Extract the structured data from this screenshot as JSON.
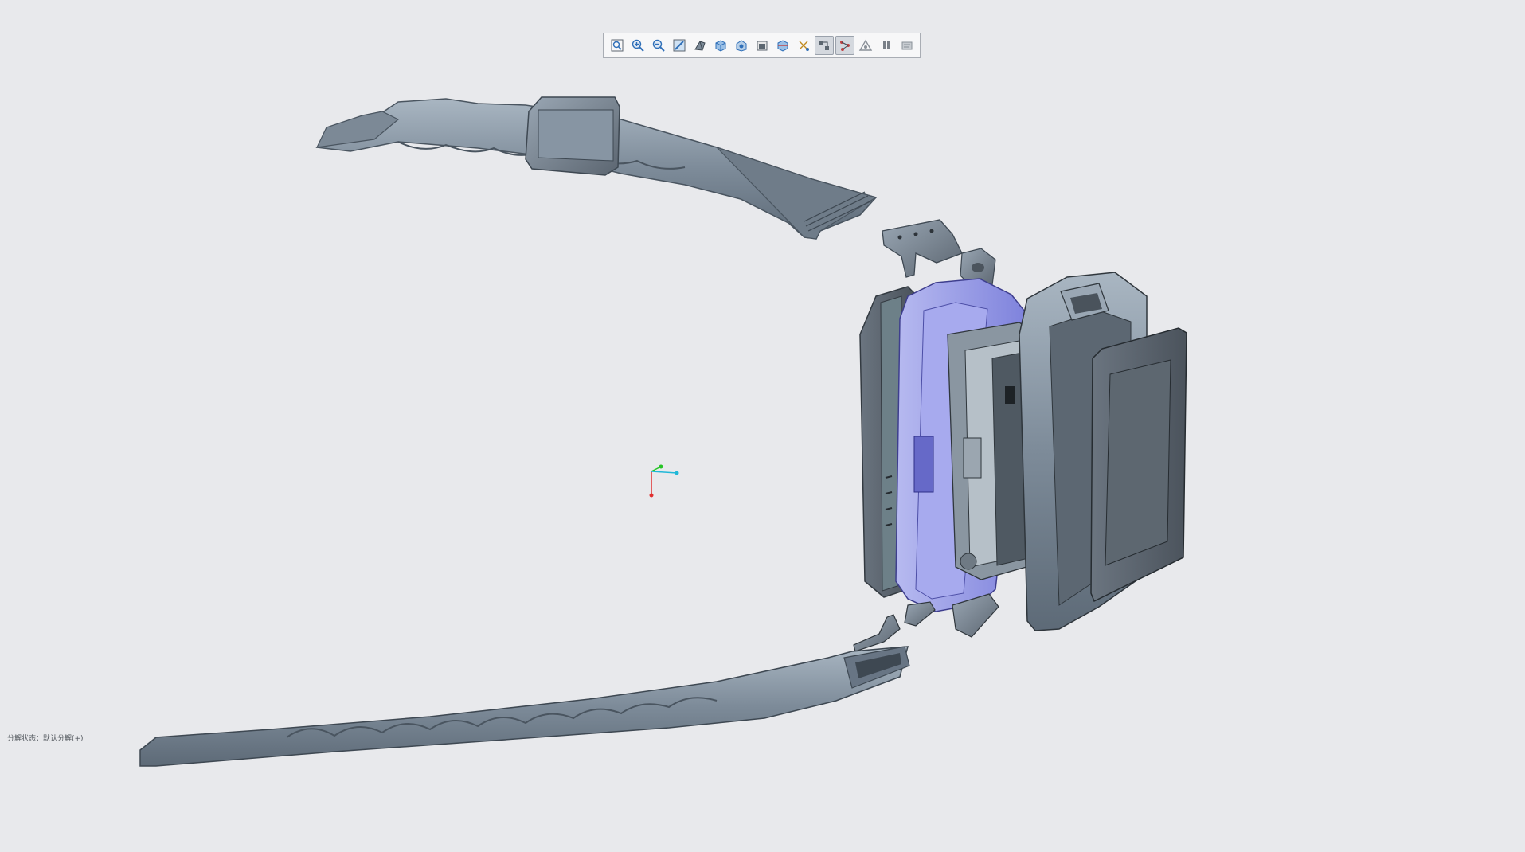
{
  "toolbar": {
    "buttons": [
      {
        "icon": "zoom-fit-icon",
        "active": false
      },
      {
        "icon": "zoom-in-icon",
        "active": false
      },
      {
        "icon": "zoom-out-icon",
        "active": false
      },
      {
        "icon": "repaint-icon",
        "active": false
      },
      {
        "icon": "perspective-icon",
        "active": false
      },
      {
        "icon": "display-style-icon",
        "active": false
      },
      {
        "icon": "saved-views-icon",
        "active": false
      },
      {
        "icon": "view-manager-icon",
        "active": false
      },
      {
        "icon": "section-view-icon",
        "active": false
      },
      {
        "icon": "datum-display-icon",
        "active": false
      },
      {
        "icon": "spin-center-icon",
        "active": true
      },
      {
        "icon": "annotation-display-icon",
        "active": true
      },
      {
        "icon": "appearance-icon",
        "active": false
      },
      {
        "icon": "pause-icon",
        "active": false
      },
      {
        "icon": "annotation-plane-icon",
        "active": false
      }
    ]
  },
  "status": {
    "text": "分解状态：默认分解(+)"
  },
  "colors": {
    "background": "#e8e9ec",
    "part_steel": "#7d8b99",
    "part_dark": "#5b6570",
    "part_light": "#a9b6c2",
    "highlight_blue": "#8f93e6",
    "triad_x": "#e03030",
    "triad_y": "#26c426",
    "triad_z": "#20b8d8"
  }
}
